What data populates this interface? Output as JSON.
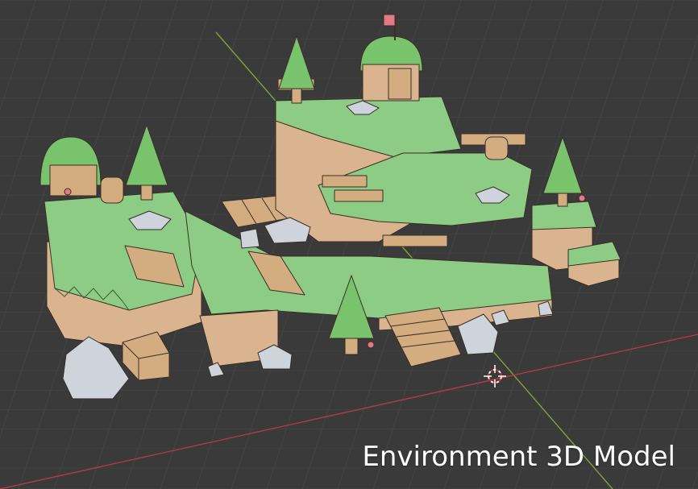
{
  "viewport": {
    "background": "#3a3a3a",
    "grid_color": "#444444",
    "x_axis_color": "#b23a48",
    "y_axis_color": "#7fa33a",
    "origin_marker": "3d-cursor-icon"
  },
  "scene": {
    "grass_color": "#8ccc84",
    "dirt_color": "#d9b48f",
    "wood_color": "#d3ad80",
    "rock_color": "#cfd3dc",
    "tree_color": "#79c36c",
    "flag_color": "#e07a86",
    "wireframe_color": "#3a2e28"
  },
  "caption": "Environment 3D Model"
}
